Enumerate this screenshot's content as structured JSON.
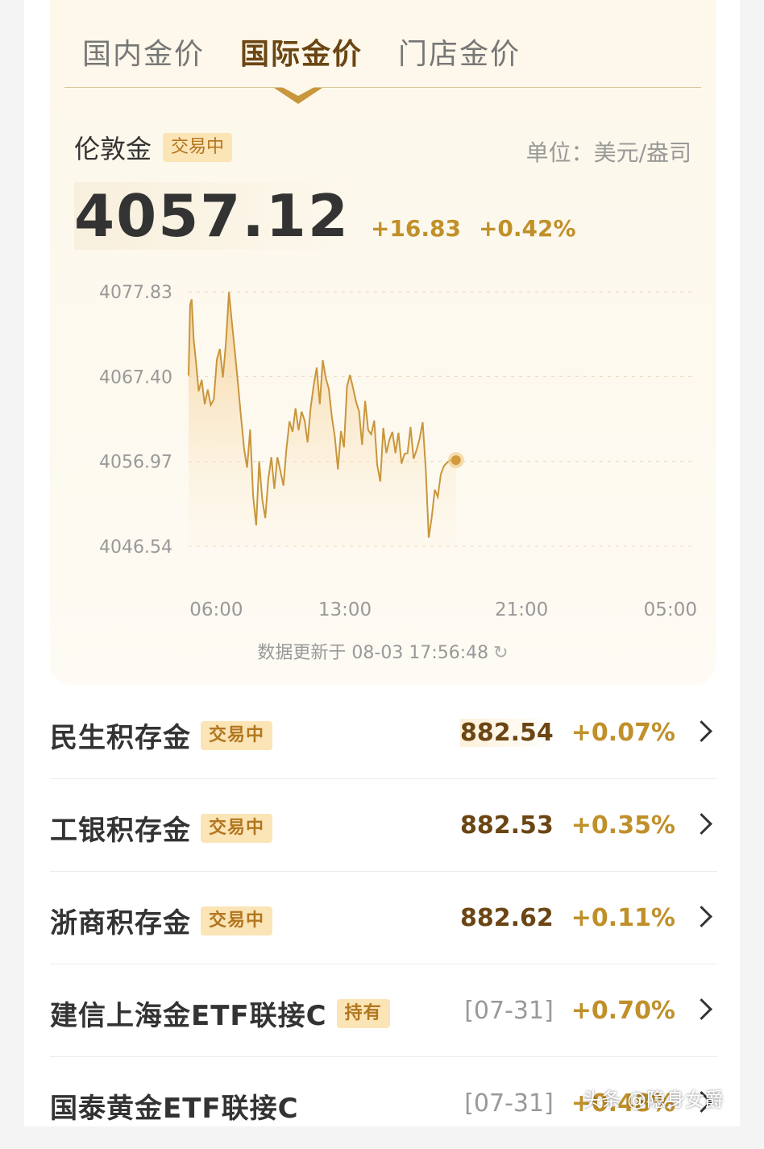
{
  "tabs": [
    {
      "label": "国内金价",
      "active": false
    },
    {
      "label": "国际金价",
      "active": true
    },
    {
      "label": "门店金价",
      "active": false
    }
  ],
  "asset": {
    "name": "伦敦金",
    "status": "交易中",
    "unit": "单位：美元/盎司",
    "price": "4057.12",
    "change": "+16.83",
    "change_pct": "+0.42%"
  },
  "chart_data": {
    "type": "area",
    "y_ticks": [
      "4077.83",
      "4067.40",
      "4056.97",
      "4046.54"
    ],
    "x_ticks": [
      "06:00",
      "13:00",
      "21:00",
      "05:00"
    ],
    "ylim": [
      4046.54,
      4077.83
    ],
    "xlim": [
      0,
      1
    ],
    "series": [
      {
        "x": [
          0.0,
          0.003,
          0.006,
          0.01,
          0.015,
          0.02,
          0.026,
          0.032,
          0.038,
          0.044,
          0.05,
          0.056,
          0.062,
          0.068,
          0.074,
          0.08,
          0.086,
          0.092,
          0.098,
          0.104,
          0.11,
          0.116,
          0.122,
          0.128,
          0.134,
          0.14,
          0.146,
          0.152,
          0.158,
          0.164,
          0.17,
          0.176,
          0.182,
          0.188,
          0.194,
          0.2,
          0.206,
          0.212,
          0.218,
          0.224,
          0.23,
          0.236,
          0.242,
          0.248,
          0.254,
          0.26,
          0.266,
          0.272,
          0.278,
          0.284,
          0.29,
          0.296,
          0.302,
          0.308,
          0.314,
          0.32,
          0.326,
          0.332,
          0.338,
          0.344,
          0.35,
          0.356,
          0.362,
          0.368,
          0.374,
          0.38,
          0.386,
          0.392,
          0.398,
          0.404,
          0.41,
          0.416,
          0.422,
          0.428,
          0.434,
          0.44,
          0.446,
          0.452,
          0.458,
          0.464,
          0.47,
          0.476,
          0.482,
          0.488,
          0.494,
          0.5,
          0.506,
          0.512,
          0.518,
          0.524,
          0.53
        ],
        "y": [
          4067.5,
          4076.2,
          4076.9,
          4072.0,
          4069.0,
          4065.6,
          4067.0,
          4064.0,
          4065.8,
          4063.9,
          4064.6,
          4069.5,
          4070.8,
          4067.3,
          4071.5,
          4077.8,
          4074.0,
          4070.3,
          4066.5,
          4062.4,
          4058.5,
          4056.2,
          4060.9,
          4052.7,
          4049.1,
          4057.0,
          4052.3,
          4050.0,
          4054.8,
          4057.5,
          4053.6,
          4057.5,
          4055.8,
          4054.0,
          4058.5,
          4061.9,
          4060.6,
          4063.5,
          4060.8,
          4063.1,
          4062.0,
          4059.3,
          4063.6,
          4066.3,
          4068.5,
          4064.0,
          4069.4,
          4067.2,
          4065.9,
          4062.4,
          4060.0,
          4056.0,
          4060.7,
          4058.7,
          4066.2,
          4067.6,
          4066.0,
          4064.3,
          4063.1,
          4059.0,
          4064.4,
          4060.8,
          4060.3,
          4062.0,
          4056.5,
          4054.5,
          4061.1,
          4058.0,
          4059.6,
          4060.6,
          4058.0,
          4060.5,
          4056.7,
          4057.9,
          4058.0,
          4061.2,
          4057.3,
          4058.4,
          4059.8,
          4061.8,
          4056.2,
          4047.6,
          4050.1,
          4053.5,
          4052.6,
          4055.4,
          4056.4,
          4056.8,
          4057.1,
          4057.0,
          4057.12
        ]
      }
    ],
    "last_point": {
      "x": 0.53,
      "y": 4057.12
    }
  },
  "update_text": "数据更新于 08-03 17:56:48",
  "funds": [
    {
      "name": "民生积存金",
      "badge": "交易中",
      "value": "882.54",
      "pct": "+0.07%",
      "highlight": true
    },
    {
      "name": "工银积存金",
      "badge": "交易中",
      "value": "882.53",
      "pct": "+0.35%",
      "highlight": false
    },
    {
      "name": "浙商积存金",
      "badge": "交易中",
      "value": "882.62",
      "pct": "+0.11%",
      "highlight": false
    },
    {
      "name": "建信上海金ETF联接C",
      "badge": "持有",
      "value": "[07-31]",
      "pct": "+0.70%",
      "highlight": false
    },
    {
      "name": "国泰黄金ETF联接C",
      "badge": "",
      "value": "[07-31]",
      "pct": "+0.48%",
      "highlight": false
    }
  ],
  "watermark": "头条 @隐身女爵",
  "colors": {
    "accent": "#c0902a",
    "dark_gold": "#6b4513",
    "badge_bg": "#fbe4b6",
    "card_bg": "#fdf8ea"
  }
}
